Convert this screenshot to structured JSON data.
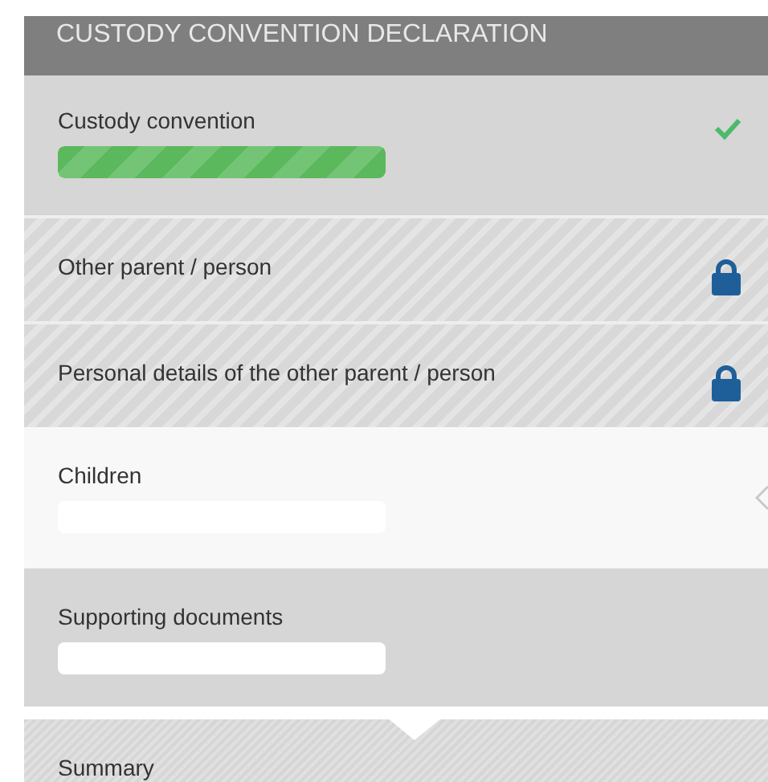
{
  "header": {
    "title": "CUSTODY CONVENTION DECLARATION"
  },
  "steps": [
    {
      "label": "Custody convention",
      "kind": "done",
      "level": 1
    },
    {
      "label": "Other parent / person",
      "kind": "locked"
    },
    {
      "label": "Personal details of the other parent / person",
      "kind": "locked"
    },
    {
      "label": "Children",
      "kind": "active",
      "level": 0
    },
    {
      "label": "Supporting documents",
      "kind": "pending",
      "level": 0
    },
    {
      "label": "Summary",
      "kind": "next"
    }
  ]
}
